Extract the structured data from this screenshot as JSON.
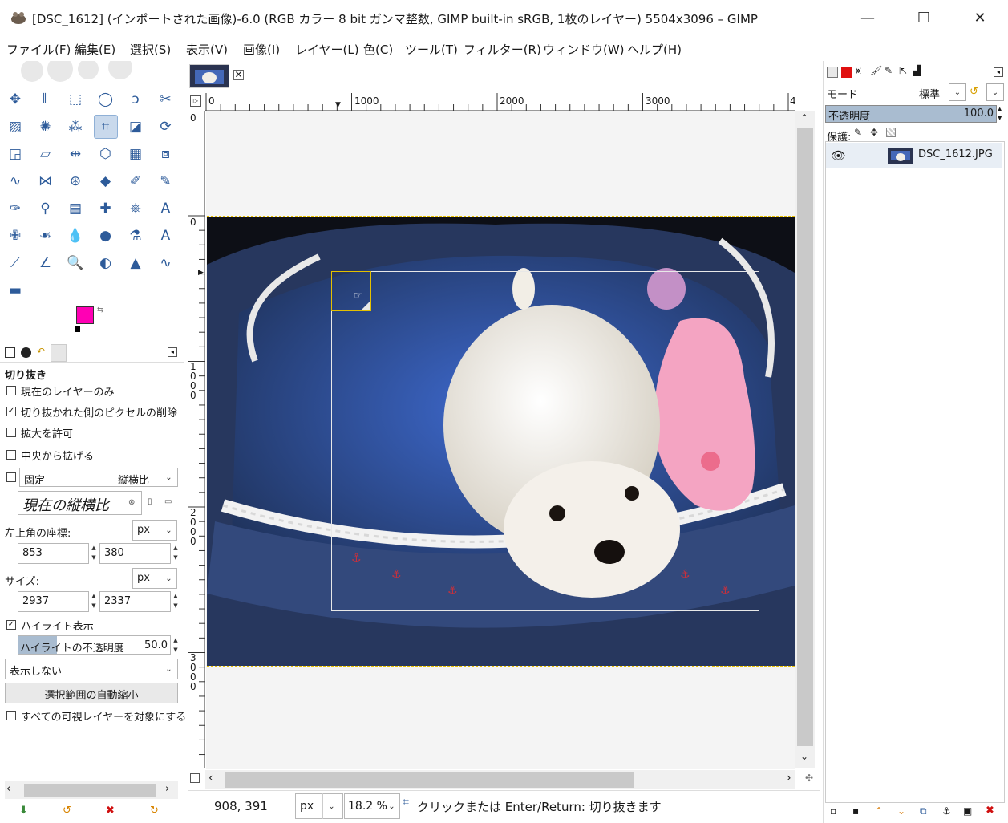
{
  "window": {
    "title": "[DSC_1612] (インポートされた画像)-6.0 (RGB カラー 8 bit ガンマ整数, GIMP built-in sRGB, 1枚のレイヤー) 5504x3096 – GIMP",
    "minimize": "—",
    "maximize": "☐",
    "close": "✕"
  },
  "menu": [
    "ファイル(F)",
    "編集(E)",
    "選択(S)",
    "表示(V)",
    "画像(I)",
    "レイヤー(L)",
    "色(C)",
    "ツール(T)",
    "フィルター(R)",
    "ウィンドウ(W)",
    "ヘルプ(H)"
  ],
  "colors": {
    "foreground": "#ff00b4",
    "background": "#ffffff",
    "accent": "#c9d9ec",
    "crop_handle": "#e4c000"
  },
  "tool_options": {
    "tab_title": "切り抜き",
    "current_layer_only": "現在のレイヤーのみ",
    "current_layer_only_checked": false,
    "delete_cropped": "切り抜かれた側のピクセルの削除",
    "delete_cropped_checked": true,
    "allow_growing": "拡大を許可",
    "allow_growing_checked": false,
    "expand_from_center": "中央から拡げる",
    "expand_from_center_checked": false,
    "fixed": "固定",
    "fixed_checked": false,
    "fixed_mode": "縦横比",
    "aspect_value": "現在の縦横比",
    "position_label": "左上角の座標:",
    "position_unit": "px",
    "pos_x": "853",
    "pos_y": "380",
    "size_label": "サイズ:",
    "size_unit": "px",
    "width": "2937",
    "height": "2337",
    "highlight": "ハイライト表示",
    "highlight_checked": true,
    "highlight_opacity_label": "ハイライトの不透明度",
    "highlight_opacity_value": "50.0",
    "highlight_opacity_fraction": 0.5,
    "guides": "表示しない",
    "auto_shrink": "選択範囲の自動縮小",
    "shrink_merged": "すべての可視レイヤーを対象にする",
    "shrink_merged_checked": false
  },
  "tools": [
    "move-icon",
    "align-icon",
    "rect-select-icon",
    "ellipse-select-icon",
    "free-select-icon",
    "scissors-select-icon",
    "fuzzy-select-icon",
    "magic-wand-icon",
    "color-select-icon",
    "crop-icon",
    "unified-transform-icon",
    "rotate-icon",
    "scale-icon",
    "shear-icon",
    "flip-icon",
    "cage-transform-icon",
    "warp-transform-icon",
    "perspective-icon",
    "smudge-icon",
    "paths-icon",
    "clone-icon",
    "eraser-icon",
    "paintbrush-icon",
    "pencil-icon",
    "ink-icon",
    "airbrush-icon",
    "mypaint-icon",
    "heal-icon",
    "stamp-icon",
    "text-icon",
    "bandaid-icon",
    "dodge-icon",
    "blur-icon",
    "fill-icon",
    "measure-icon",
    "text-tool-icon",
    "color-picker-icon",
    "measure-angle-icon",
    "zoom-icon",
    "dodge-burn-icon",
    "levels-icon",
    "curves-icon",
    "gradient-icon"
  ],
  "canvas": {
    "ruler_top": [
      "0",
      "1000",
      "2000",
      "3000",
      "4"
    ],
    "ruler_left_0a": "0",
    "ruler_left_0b": "0",
    "ruler_left_1000": "1\n0\n0\n0",
    "ruler_left_2000": "2\n0\n0\n0",
    "ruler_left_3000": "3\n0\n0\n0"
  },
  "status": {
    "coords": "908, 391",
    "unit": "px",
    "zoom": "18.2 %",
    "message": "クリックまたは Enter/Return: 切り抜きます"
  },
  "layers": {
    "mode_label": "モード",
    "mode_value": "標準",
    "opacity_label": "不透明度",
    "opacity_value": "100.0",
    "lock_label": "保護:",
    "layer_name": "DSC_1612.JPG"
  }
}
